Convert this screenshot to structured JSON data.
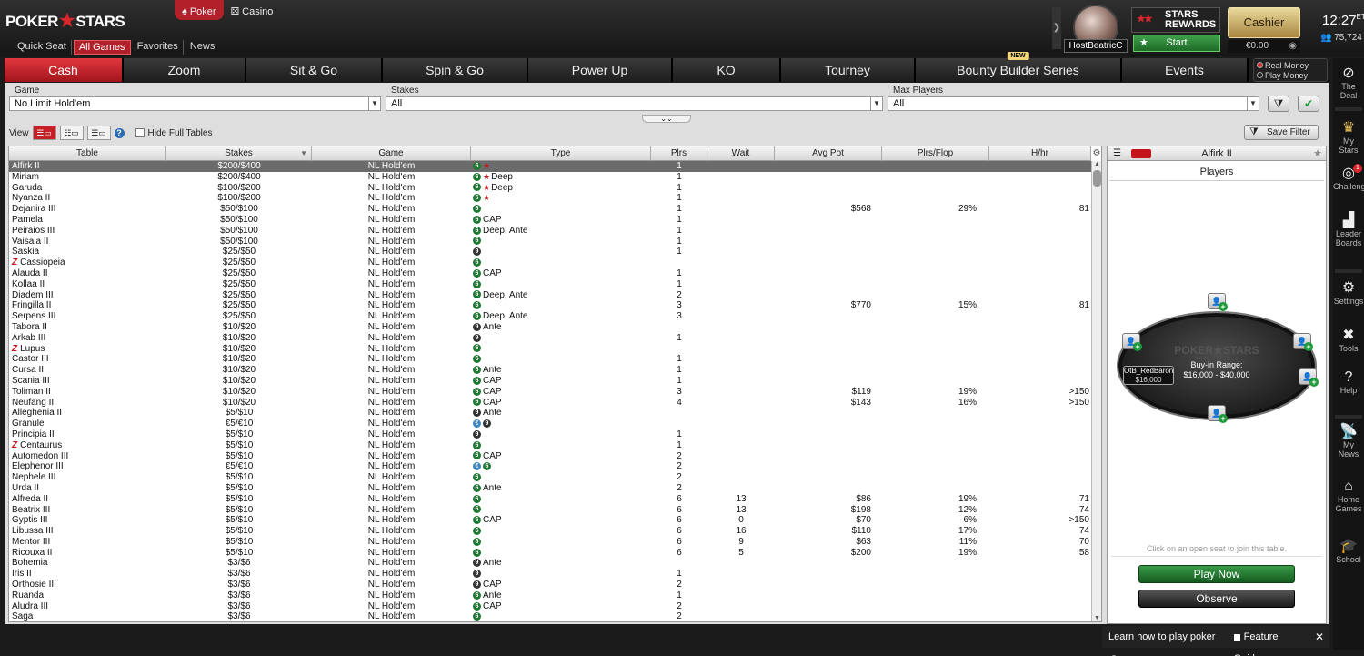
{
  "brand": {
    "logo_left": "POKER",
    "logo_right": "STARS"
  },
  "product_tabs": [
    {
      "label": "Poker",
      "icon": "spade-icon",
      "active": true
    },
    {
      "label": "Casino",
      "icon": "dice-icon",
      "active": false
    }
  ],
  "top_nav": [
    {
      "label": "Quick Seat",
      "active": false
    },
    {
      "label": "All Games",
      "active": true
    },
    {
      "label": "Favorites",
      "active": false
    },
    {
      "label": "News",
      "active": false
    }
  ],
  "user": {
    "name": "HostBeatricC"
  },
  "rewards": {
    "line1": "STARS",
    "line2": "REWARDS",
    "start_label": "Start"
  },
  "cashier": {
    "label": "Cashier",
    "balance": "€0.00"
  },
  "clock": {
    "time": "12:27",
    "tz": "ET",
    "players_online": "75,724"
  },
  "game_tabs": [
    {
      "label": "Cash",
      "active": true,
      "badge": ""
    },
    {
      "label": "Zoom",
      "active": false,
      "badge": ""
    },
    {
      "label": "Sit & Go",
      "active": false,
      "badge": ""
    },
    {
      "label": "Spin & Go",
      "active": false,
      "badge": ""
    },
    {
      "label": "Power Up",
      "active": false,
      "badge": ""
    },
    {
      "label": "KO",
      "active": false,
      "badge": ""
    },
    {
      "label": "Tourney",
      "active": false,
      "badge": ""
    },
    {
      "label": "Bounty Builder Series",
      "active": false,
      "badge": "NEW"
    },
    {
      "label": "Events",
      "active": false,
      "badge": ""
    }
  ],
  "money_mode": {
    "real": "Real Money",
    "play": "Play Money",
    "selected": "real"
  },
  "filters": {
    "game_label": "Game",
    "game_value": "No Limit Hold'em",
    "stakes_label": "Stakes",
    "stakes_value": "All",
    "max_players_label": "Max Players",
    "max_players_value": "All"
  },
  "view": {
    "label": "View",
    "hide_full_label": "Hide Full Tables",
    "save_filter_label": "Save Filter"
  },
  "table_headers": [
    "Table",
    "Stakes",
    "Game",
    "Type",
    "Plrs",
    "Wait",
    "Avg Pot",
    "Plrs/Flop",
    "H/hr"
  ],
  "rows": [
    {
      "table": "Alfirk II",
      "zoom": false,
      "stakes": "$200/$400",
      "game": "NL Hold'em",
      "seats": [
        "6"
      ],
      "deep": true,
      "type": "",
      "plrs": "1",
      "wait": "",
      "avg_pot": "",
      "plrs_flop": "",
      "hhr": "",
      "selected": true
    },
    {
      "table": "Miriam",
      "zoom": false,
      "stakes": "$200/$400",
      "game": "NL Hold'em",
      "seats": [
        "6"
      ],
      "deep": true,
      "type": "Deep",
      "plrs": "1",
      "wait": "",
      "avg_pot": "",
      "plrs_flop": "",
      "hhr": ""
    },
    {
      "table": "Garuda",
      "zoom": false,
      "stakes": "$100/$200",
      "game": "NL Hold'em",
      "seats": [
        "6"
      ],
      "deep": true,
      "type": "Deep",
      "plrs": "1",
      "wait": "",
      "avg_pot": "",
      "plrs_flop": "",
      "hhr": ""
    },
    {
      "table": "Nyanza II",
      "zoom": false,
      "stakes": "$100/$200",
      "game": "NL Hold'em",
      "seats": [
        "6"
      ],
      "deep": true,
      "type": "",
      "plrs": "1",
      "wait": "",
      "avg_pot": "",
      "plrs_flop": "",
      "hhr": ""
    },
    {
      "table": "Dejanira III",
      "zoom": false,
      "stakes": "$50/$100",
      "game": "NL Hold'em",
      "seats": [
        "6"
      ],
      "deep": false,
      "type": "",
      "plrs": "1",
      "wait": "",
      "avg_pot": "$568",
      "plrs_flop": "29%",
      "hhr": "81"
    },
    {
      "table": "Pamela",
      "zoom": false,
      "stakes": "$50/$100",
      "game": "NL Hold'em",
      "seats": [
        "6"
      ],
      "deep": false,
      "type": "CAP",
      "plrs": "1",
      "wait": "",
      "avg_pot": "",
      "plrs_flop": "",
      "hhr": ""
    },
    {
      "table": "Peiraios III",
      "zoom": false,
      "stakes": "$50/$100",
      "game": "NL Hold'em",
      "seats": [
        "6"
      ],
      "deep": false,
      "type": "Deep, Ante",
      "plrs": "1",
      "wait": "",
      "avg_pot": "",
      "plrs_flop": "",
      "hhr": ""
    },
    {
      "table": "Vaisala II",
      "zoom": false,
      "stakes": "$50/$100",
      "game": "NL Hold'em",
      "seats": [
        "6"
      ],
      "deep": false,
      "type": "",
      "plrs": "1",
      "wait": "",
      "avg_pot": "",
      "plrs_flop": "",
      "hhr": ""
    },
    {
      "table": "Saskia",
      "zoom": false,
      "stakes": "$25/$50",
      "game": "NL Hold'em",
      "seats": [
        "9"
      ],
      "deep": false,
      "type": "",
      "plrs": "1",
      "wait": "",
      "avg_pot": "",
      "plrs_flop": "",
      "hhr": ""
    },
    {
      "table": "Cassiopeia",
      "zoom": true,
      "stakes": "$25/$50",
      "game": "NL Hold'em",
      "seats": [
        "6"
      ],
      "deep": false,
      "type": "",
      "plrs": "",
      "wait": "",
      "avg_pot": "",
      "plrs_flop": "",
      "hhr": ""
    },
    {
      "table": "Alauda II",
      "zoom": false,
      "stakes": "$25/$50",
      "game": "NL Hold'em",
      "seats": [
        "6"
      ],
      "deep": false,
      "type": "CAP",
      "plrs": "1",
      "wait": "",
      "avg_pot": "",
      "plrs_flop": "",
      "hhr": ""
    },
    {
      "table": "Kollaa II",
      "zoom": false,
      "stakes": "$25/$50",
      "game": "NL Hold'em",
      "seats": [
        "6"
      ],
      "deep": false,
      "type": "",
      "plrs": "1",
      "wait": "",
      "avg_pot": "",
      "plrs_flop": "",
      "hhr": ""
    },
    {
      "table": "Diadem III",
      "zoom": false,
      "stakes": "$25/$50",
      "game": "NL Hold'em",
      "seats": [
        "6"
      ],
      "deep": false,
      "type": "Deep, Ante",
      "plrs": "2",
      "wait": "",
      "avg_pot": "",
      "plrs_flop": "",
      "hhr": ""
    },
    {
      "table": "Fringilla II",
      "zoom": false,
      "stakes": "$25/$50",
      "game": "NL Hold'em",
      "seats": [
        "6"
      ],
      "deep": false,
      "type": "",
      "plrs": "3",
      "wait": "",
      "avg_pot": "$770",
      "plrs_flop": "15%",
      "hhr": "81"
    },
    {
      "table": "Serpens III",
      "zoom": false,
      "stakes": "$25/$50",
      "game": "NL Hold'em",
      "seats": [
        "6"
      ],
      "deep": false,
      "type": "Deep, Ante",
      "plrs": "3",
      "wait": "",
      "avg_pot": "",
      "plrs_flop": "",
      "hhr": ""
    },
    {
      "table": "Tabora II",
      "zoom": false,
      "stakes": "$10/$20",
      "game": "NL Hold'em",
      "seats": [
        "9"
      ],
      "deep": false,
      "type": "Ante",
      "plrs": "",
      "wait": "",
      "avg_pot": "",
      "plrs_flop": "",
      "hhr": ""
    },
    {
      "table": "Arkab III",
      "zoom": false,
      "stakes": "$10/$20",
      "game": "NL Hold'em",
      "seats": [
        "9"
      ],
      "deep": false,
      "type": "",
      "plrs": "1",
      "wait": "",
      "avg_pot": "",
      "plrs_flop": "",
      "hhr": ""
    },
    {
      "table": "Lupus",
      "zoom": true,
      "stakes": "$10/$20",
      "game": "NL Hold'em",
      "seats": [
        "6"
      ],
      "deep": false,
      "type": "",
      "plrs": "",
      "wait": "",
      "avg_pot": "",
      "plrs_flop": "",
      "hhr": ""
    },
    {
      "table": "Castor III",
      "zoom": false,
      "stakes": "$10/$20",
      "game": "NL Hold'em",
      "seats": [
        "6"
      ],
      "deep": false,
      "type": "",
      "plrs": "1",
      "wait": "",
      "avg_pot": "",
      "plrs_flop": "",
      "hhr": ""
    },
    {
      "table": "Cursa II",
      "zoom": false,
      "stakes": "$10/$20",
      "game": "NL Hold'em",
      "seats": [
        "6"
      ],
      "deep": false,
      "type": "Ante",
      "plrs": "1",
      "wait": "",
      "avg_pot": "",
      "plrs_flop": "",
      "hhr": ""
    },
    {
      "table": "Scania III",
      "zoom": false,
      "stakes": "$10/$20",
      "game": "NL Hold'em",
      "seats": [
        "6"
      ],
      "deep": false,
      "type": "CAP",
      "plrs": "1",
      "wait": "",
      "avg_pot": "",
      "plrs_flop": "",
      "hhr": ""
    },
    {
      "table": "Toliman II",
      "zoom": false,
      "stakes": "$10/$20",
      "game": "NL Hold'em",
      "seats": [
        "6"
      ],
      "deep": false,
      "type": "CAP",
      "plrs": "3",
      "wait": "",
      "avg_pot": "$119",
      "plrs_flop": "19%",
      "hhr": ">150"
    },
    {
      "table": "Neufang II",
      "zoom": false,
      "stakes": "$10/$20",
      "game": "NL Hold'em",
      "seats": [
        "6"
      ],
      "deep": false,
      "type": "CAP",
      "plrs": "4",
      "wait": "",
      "avg_pot": "$143",
      "plrs_flop": "16%",
      "hhr": ">150"
    },
    {
      "table": "Alleghenia II",
      "zoom": false,
      "stakes": "$5/$10",
      "game": "NL Hold'em",
      "seats": [
        "9"
      ],
      "deep": false,
      "type": "Ante",
      "plrs": "",
      "wait": "",
      "avg_pot": "",
      "plrs_flop": "",
      "hhr": ""
    },
    {
      "table": "Granule",
      "zoom": false,
      "stakes": "€5/€10",
      "game": "NL Hold'em",
      "seats": [
        "€",
        "9"
      ],
      "deep": false,
      "type": "",
      "plrs": "",
      "wait": "",
      "avg_pot": "",
      "plrs_flop": "",
      "hhr": ""
    },
    {
      "table": "Principia II",
      "zoom": false,
      "stakes": "$5/$10",
      "game": "NL Hold'em",
      "seats": [
        "9"
      ],
      "deep": false,
      "type": "",
      "plrs": "1",
      "wait": "",
      "avg_pot": "",
      "plrs_flop": "",
      "hhr": ""
    },
    {
      "table": "Centaurus",
      "zoom": true,
      "stakes": "$5/$10",
      "game": "NL Hold'em",
      "seats": [
        "6"
      ],
      "deep": false,
      "type": "",
      "plrs": "1",
      "wait": "",
      "avg_pot": "",
      "plrs_flop": "",
      "hhr": ""
    },
    {
      "table": "Automedon III",
      "zoom": false,
      "stakes": "$5/$10",
      "game": "NL Hold'em",
      "seats": [
        "6"
      ],
      "deep": false,
      "type": "CAP",
      "plrs": "2",
      "wait": "",
      "avg_pot": "",
      "plrs_flop": "",
      "hhr": ""
    },
    {
      "table": "Elephenor III",
      "zoom": false,
      "stakes": "€5/€10",
      "game": "NL Hold'em",
      "seats": [
        "€",
        "6"
      ],
      "deep": false,
      "type": "",
      "plrs": "2",
      "wait": "",
      "avg_pot": "",
      "plrs_flop": "",
      "hhr": ""
    },
    {
      "table": "Nephele III",
      "zoom": false,
      "stakes": "$5/$10",
      "game": "NL Hold'em",
      "seats": [
        "6"
      ],
      "deep": false,
      "type": "",
      "plrs": "2",
      "wait": "",
      "avg_pot": "",
      "plrs_flop": "",
      "hhr": ""
    },
    {
      "table": "Urda II",
      "zoom": false,
      "stakes": "$5/$10",
      "game": "NL Hold'em",
      "seats": [
        "6"
      ],
      "deep": false,
      "type": "Ante",
      "plrs": "2",
      "wait": "",
      "avg_pot": "",
      "plrs_flop": "",
      "hhr": ""
    },
    {
      "table": "Alfreda II",
      "zoom": false,
      "stakes": "$5/$10",
      "game": "NL Hold'em",
      "seats": [
        "6"
      ],
      "deep": false,
      "type": "",
      "plrs": "6",
      "wait": "13",
      "avg_pot": "$86",
      "plrs_flop": "19%",
      "hhr": "71"
    },
    {
      "table": "Beatrix III",
      "zoom": false,
      "stakes": "$5/$10",
      "game": "NL Hold'em",
      "seats": [
        "6"
      ],
      "deep": false,
      "type": "",
      "plrs": "6",
      "wait": "13",
      "avg_pot": "$198",
      "plrs_flop": "12%",
      "hhr": "74"
    },
    {
      "table": "Gyptis III",
      "zoom": false,
      "stakes": "$5/$10",
      "game": "NL Hold'em",
      "seats": [
        "6"
      ],
      "deep": false,
      "type": "CAP",
      "plrs": "6",
      "wait": "0",
      "avg_pot": "$70",
      "plrs_flop": "6%",
      "hhr": ">150"
    },
    {
      "table": "Libussa III",
      "zoom": false,
      "stakes": "$5/$10",
      "game": "NL Hold'em",
      "seats": [
        "6"
      ],
      "deep": false,
      "type": "",
      "plrs": "6",
      "wait": "16",
      "avg_pot": "$110",
      "plrs_flop": "17%",
      "hhr": "74"
    },
    {
      "table": "Mentor III",
      "zoom": false,
      "stakes": "$5/$10",
      "game": "NL Hold'em",
      "seats": [
        "6"
      ],
      "deep": false,
      "type": "",
      "plrs": "6",
      "wait": "9",
      "avg_pot": "$63",
      "plrs_flop": "11%",
      "hhr": "70"
    },
    {
      "table": "Ricouxa II",
      "zoom": false,
      "stakes": "$5/$10",
      "game": "NL Hold'em",
      "seats": [
        "6"
      ],
      "deep": false,
      "type": "",
      "plrs": "6",
      "wait": "5",
      "avg_pot": "$200",
      "plrs_flop": "19%",
      "hhr": "58"
    },
    {
      "table": "Bohemia",
      "zoom": false,
      "stakes": "$3/$6",
      "game": "NL Hold'em",
      "seats": [
        "9"
      ],
      "deep": false,
      "type": "Ante",
      "plrs": "",
      "wait": "",
      "avg_pot": "",
      "plrs_flop": "",
      "hhr": ""
    },
    {
      "table": "Iris II",
      "zoom": false,
      "stakes": "$3/$6",
      "game": "NL Hold'em",
      "seats": [
        "9"
      ],
      "deep": false,
      "type": "",
      "plrs": "1",
      "wait": "",
      "avg_pot": "",
      "plrs_flop": "",
      "hhr": ""
    },
    {
      "table": "Orthosie III",
      "zoom": false,
      "stakes": "$3/$6",
      "game": "NL Hold'em",
      "seats": [
        "9"
      ],
      "deep": false,
      "type": "CAP",
      "plrs": "2",
      "wait": "",
      "avg_pot": "",
      "plrs_flop": "",
      "hhr": ""
    },
    {
      "table": "Ruanda",
      "zoom": false,
      "stakes": "$3/$6",
      "game": "NL Hold'em",
      "seats": [
        "6"
      ],
      "deep": false,
      "type": "Ante",
      "plrs": "1",
      "wait": "",
      "avg_pot": "",
      "plrs_flop": "",
      "hhr": ""
    },
    {
      "table": "Aludra III",
      "zoom": false,
      "stakes": "$3/$6",
      "game": "NL Hold'em",
      "seats": [
        "6"
      ],
      "deep": false,
      "type": "CAP",
      "plrs": "2",
      "wait": "",
      "avg_pot": "",
      "plrs_flop": "",
      "hhr": ""
    },
    {
      "table": "Saga",
      "zoom": false,
      "stakes": "$3/$6",
      "game": "NL Hold'em",
      "seats": [
        "6"
      ],
      "deep": false,
      "type": "",
      "plrs": "2",
      "wait": "",
      "avg_pot": "",
      "plrs_flop": "",
      "hhr": ""
    }
  ],
  "preview": {
    "title": "Alfirk II",
    "tab_label": "Players",
    "logo_text": "POKER★STARS",
    "buyin_label": "Buy-in Range:",
    "buyin_range": "$16,000 - $40,000",
    "player_name": "OtB_RedBaron",
    "player_stack": "$16,000",
    "join_hint": "Click on an open seat to join this table.",
    "play_now_label": "Play Now",
    "observe_label": "Observe"
  },
  "right_rail": [
    {
      "label": "The Deal",
      "icon": "deal-icon"
    },
    {
      "label": "My Stars",
      "icon": "trophy-icon"
    },
    {
      "label": "Challenges",
      "icon": "target-icon",
      "badge": "1"
    },
    {
      "label": "Leader Boards",
      "icon": "podium-icon"
    },
    {
      "label": "Settings",
      "icon": "gear-icon"
    },
    {
      "label": "Tools",
      "icon": "tools-icon"
    },
    {
      "label": "Help",
      "icon": "help-icon"
    },
    {
      "label": "My News",
      "icon": "satellite-icon"
    },
    {
      "label": "Home Games",
      "icon": "home-icon"
    },
    {
      "label": "School",
      "icon": "graduation-cap-icon"
    }
  ],
  "footer": {
    "learn_label": "Learn how to play poker",
    "feature_guide_label": "Feature Guide"
  },
  "colors": {
    "accent": "#c4141c",
    "green": "#1d7a33",
    "gold": "#c9ad62"
  }
}
